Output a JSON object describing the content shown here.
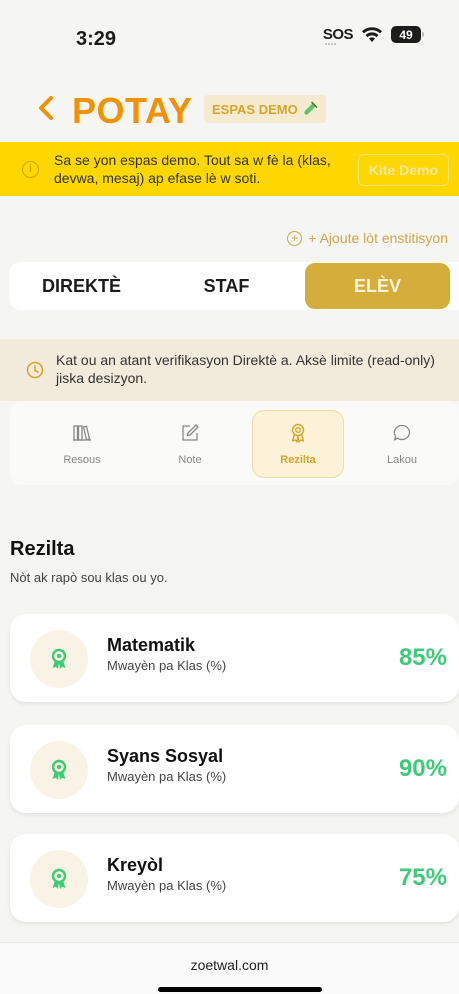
{
  "status_bar": {
    "time": "3:29",
    "sos": "SOS",
    "battery": "49"
  },
  "header": {
    "back_icon": "chevron-left-icon",
    "title": "POTAY",
    "demo_badge": "ESPAS DEMO",
    "badge_icon": "test-tube-icon"
  },
  "demo_banner": {
    "text": "Sa se yon espas demo. Tout sa w fè la (klas, devwa, mesaj) ap efase lè w soti.",
    "button": "Kite Demo",
    "icon": "info-icon"
  },
  "add_institution": "+ Ajoute lòt enstitisyon",
  "role_tabs": [
    {
      "label": "DIREKTÈ"
    },
    {
      "label": "STAF"
    },
    {
      "label": "ELÈV"
    }
  ],
  "verification_banner": {
    "text": "Kat ou an atant verifikasyon Direktè a. Aksè limite (read-only) jiska desizyon.",
    "icon": "clock-icon"
  },
  "sub_tabs": [
    {
      "label": "Resous",
      "icon": "library-icon"
    },
    {
      "label": "Note",
      "icon": "edit-note-icon"
    },
    {
      "label": "Rezilta",
      "icon": "award-icon"
    },
    {
      "label": "Lakou",
      "icon": "chat-bubble-icon"
    }
  ],
  "section": {
    "title": "Rezilta",
    "subtitle": "Nòt ak rapò sou klas ou yo."
  },
  "results": [
    {
      "subject": "Matematik",
      "desc": "Mwayèn pa Klas (%)",
      "score": "85%"
    },
    {
      "subject": "Syans Sosyal",
      "desc": "Mwayèn pa Klas (%)",
      "score": "90%"
    },
    {
      "subject": "Kreyòl",
      "desc": "Mwayèn pa Klas (%)",
      "score": "75%"
    }
  ],
  "footer": {
    "text": "zoetwal.com"
  },
  "colors": {
    "brand_orange": "#f39200",
    "gold": "#d4ad3a",
    "banner_yellow": "#fed700",
    "score_green": "#3ecb78"
  }
}
